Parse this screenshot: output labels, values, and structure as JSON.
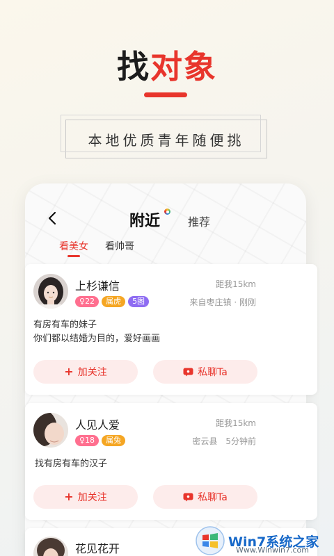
{
  "hero": {
    "title_part1": "找",
    "title_part2": "对象",
    "tagline": "本地优质青年随便挑"
  },
  "nav": {
    "title": "附近",
    "secondary": "推荐"
  },
  "tabs": [
    {
      "label": "看美女",
      "active": true
    },
    {
      "label": "看帅哥",
      "active": false
    }
  ],
  "cards": [
    {
      "name": "上杉谦信",
      "age": "22",
      "zodiac": "属虎",
      "photos": "5图",
      "distance": "距我15km",
      "origin": "来自枣庄镇 · 刚刚",
      "bio_line1": "有房有车的妹子",
      "bio_line2": "你们都以结婚为目的，爱好画画",
      "follow_label": "加关注",
      "chat_label": "私聊Ta"
    },
    {
      "name": "人见人爱",
      "age": "18",
      "zodiac": "属兔",
      "distance": "距我15km",
      "origin": "密云县　5分钟前",
      "bio_line1": "找有房有车的汉子",
      "follow_label": "加关注",
      "chat_label": "私聊Ta"
    },
    {
      "name": "花见花开"
    }
  ],
  "watermark": {
    "brand": "Win7系统之家",
    "url": "Www.Winwin7.com"
  },
  "colors": {
    "accent": "#e8352c",
    "age_tag": "#ff6f8f",
    "zodiac_tag": "#f5a623",
    "photos_tag": "#8e6cf2"
  }
}
